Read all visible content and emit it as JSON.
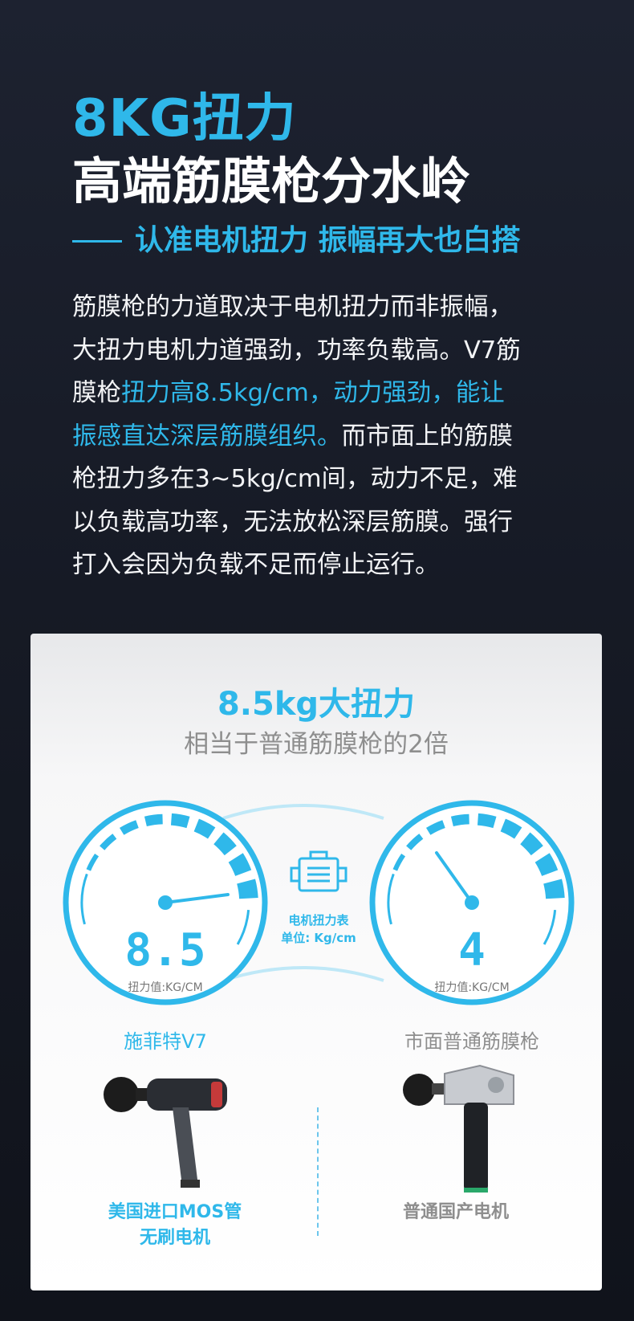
{
  "hero": {
    "headline_top": "8KG扭力",
    "headline_main": "高端筋膜枪分水岭",
    "tagline": "认准电机扭力 振幅再大也白搭"
  },
  "body": {
    "lines": [
      [
        {
          "t": "筋膜枪的力道取决于电机扭力而非振幅，",
          "hl": false
        }
      ],
      [
        {
          "t": "大扭力电机力道强劲，功率负载高。V7筋",
          "hl": false
        }
      ],
      [
        {
          "t": "膜枪",
          "hl": false
        },
        {
          "t": "扭力高8.5kg/cm，动力强劲，能让",
          "hl": true
        }
      ],
      [
        {
          "t": "振感直达深层筋膜组织。",
          "hl": true
        },
        {
          "t": "而市面上的筋膜",
          "hl": false
        }
      ],
      [
        {
          "t": "枪扭力多在3~5kg/cm间，动力不足，难",
          "hl": false
        }
      ],
      [
        {
          "t": "以负载高功率，无法放松深层筋膜。强行",
          "hl": false
        }
      ],
      [
        {
          "t": "打入会因为负载不足而停止运行。",
          "hl": false
        }
      ]
    ]
  },
  "comparison": {
    "title": "8.5kg大扭力",
    "subtitle": "相当于普通筋膜枪的2倍",
    "center_label_1": "电机扭力表",
    "center_label_2": "单位: Kg/cm",
    "center_icon": "motor-icon",
    "gauge_left": {
      "reading": "8.5",
      "unit": "扭力值:KG/CM",
      "name": "施菲特V7",
      "value": 8.5
    },
    "gauge_right": {
      "reading": "4",
      "unit": "扭力值:KG/CM",
      "name": "市面普通筋膜枪",
      "value": 4
    },
    "product_left": {
      "line1": "美国进口MOS管",
      "line2": "无刷电机",
      "icon": "massage-gun-dark-icon"
    },
    "product_right": {
      "line1": "普通国产电机",
      "icon": "massage-gun-silver-icon"
    },
    "colors": {
      "accent": "#2fb8ea",
      "muted": "#8e8e8e"
    }
  }
}
